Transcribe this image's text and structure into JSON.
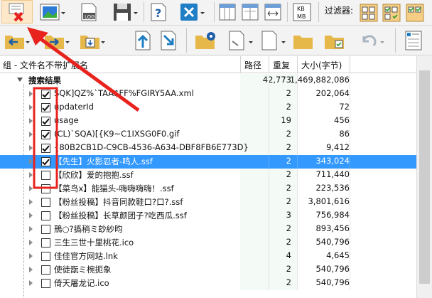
{
  "toolbar": {
    "filter_label": "过滤器:",
    "log_label": "LOG",
    "kb_top": "KB",
    "kb_bottom": "MB"
  },
  "header": {
    "group_col": "组 - 文件名不带扩展名",
    "path_col": "路径",
    "dup_col": "重复",
    "size_col": "大小(字节)"
  },
  "group_row": {
    "label": "搜索结果",
    "count": "42,773",
    "size": "1,469,882,086"
  },
  "rows": [
    {
      "name": "SQK]QZ%`TAA$FF%FGIRY5AA.xml",
      "count": "2",
      "size": "202,064",
      "checked": true
    },
    {
      "name": "updaterId",
      "count": "2",
      "size": "72",
      "checked": true
    },
    {
      "name": "usage",
      "count": "19",
      "size": "456",
      "checked": true
    },
    {
      "name": "(CL)`SQA)[{K9~C1IXSG0F0.gif",
      "count": "2",
      "size": "86",
      "checked": true
    },
    {
      "name": "{80B2CB1D-C9CB-4536-A634-DBF8FB6E773D}",
      "count": "2",
      "size": "9,412",
      "checked": true
    },
    {
      "name": "【先生】火影忍者-鸣人.ssf",
      "count": "2",
      "size": "343,024",
      "checked": true,
      "selected": true
    },
    {
      "name": "【欣欣】爱的抱抱.ssf",
      "count": "2",
      "size": "711,440",
      "checked": false
    },
    {
      "name": "【菜鸟x】能猫头-嗨嗨嗨嗨！.ssf",
      "count": "2",
      "size": "223,536",
      "checked": false
    },
    {
      "name": "【粉丝投稿】抖音同款鞋口?口?.ssf",
      "count": "2",
      "size": "3,801,616",
      "checked": false
    },
    {
      "name": "【粉丝投稿】长草颜团子?吃西瓜.ssf",
      "count": "3",
      "size": "756,984",
      "checked": false
    },
    {
      "name": "鳽○?撝稍ミ玅紗昀",
      "count": "2",
      "size": "893,456",
      "checked": false
    },
    {
      "name": "三生三世十里桃花.ico",
      "count": "2",
      "size": "540,796",
      "checked": false
    },
    {
      "name": "佳佳官方网站.lnk",
      "count": "4",
      "size": "4,645",
      "checked": false
    },
    {
      "name": "使徒翫ミ椀扼象",
      "count": "2",
      "size": "540,796",
      "checked": false
    },
    {
      "name": "倚天屠龙记.ico",
      "count": "2",
      "size": "540,796",
      "checked": false
    }
  ],
  "colors": {
    "selection": "#3399ff",
    "annotation_red": "#e8231e",
    "accent_blue": "#1f7ec4"
  }
}
